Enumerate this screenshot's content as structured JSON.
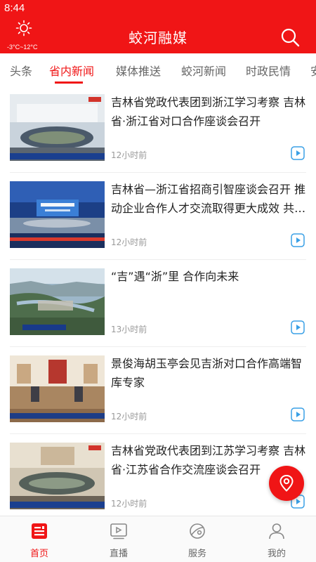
{
  "status_bar": {
    "time": "8:44"
  },
  "header": {
    "title": "蛟河融媒",
    "weather_temp": "-3°C~12°C",
    "weather_icon": "sun-icon",
    "search_icon": "search-icon",
    "brand_color": "#f01516"
  },
  "tabs": [
    {
      "label": "头条",
      "active": false
    },
    {
      "label": "省内新闻",
      "active": true
    },
    {
      "label": "媒体推送",
      "active": false
    },
    {
      "label": "蛟河新闻",
      "active": false
    },
    {
      "label": "时政民情",
      "active": false
    },
    {
      "label": "安",
      "active": false
    }
  ],
  "feed": {
    "items": [
      {
        "title": "吉林省党政代表团到浙江学习考察 吉林省·浙江省对口合作座谈会召开",
        "time": "12小时前",
        "has_video": true
      },
      {
        "title": "吉林省—浙江省招商引智座谈会召开 推动企业合作人才交流取得更大成效 共…",
        "time": "12小时前",
        "has_video": true
      },
      {
        "title": "“吉”遇“浙”里 合作向未来",
        "time": "13小时前",
        "has_video": true
      },
      {
        "title": "景俊海胡玉亭会见吉浙对口合作高端智库专家",
        "time": "12小时前",
        "has_video": true
      },
      {
        "title": "吉林省党政代表团到江苏学习考察 吉林省·江苏省合作交流座谈会召开",
        "time": "12小时前",
        "has_video": true
      }
    ]
  },
  "fab": {
    "icon": "location-pin-icon"
  },
  "bottom_nav": [
    {
      "label": "首页",
      "icon": "news-home-icon",
      "active": true
    },
    {
      "label": "直播",
      "icon": "live-video-icon",
      "active": false
    },
    {
      "label": "服务",
      "icon": "service-planet-icon",
      "active": false
    },
    {
      "label": "我的",
      "icon": "user-profile-icon",
      "active": false
    }
  ]
}
